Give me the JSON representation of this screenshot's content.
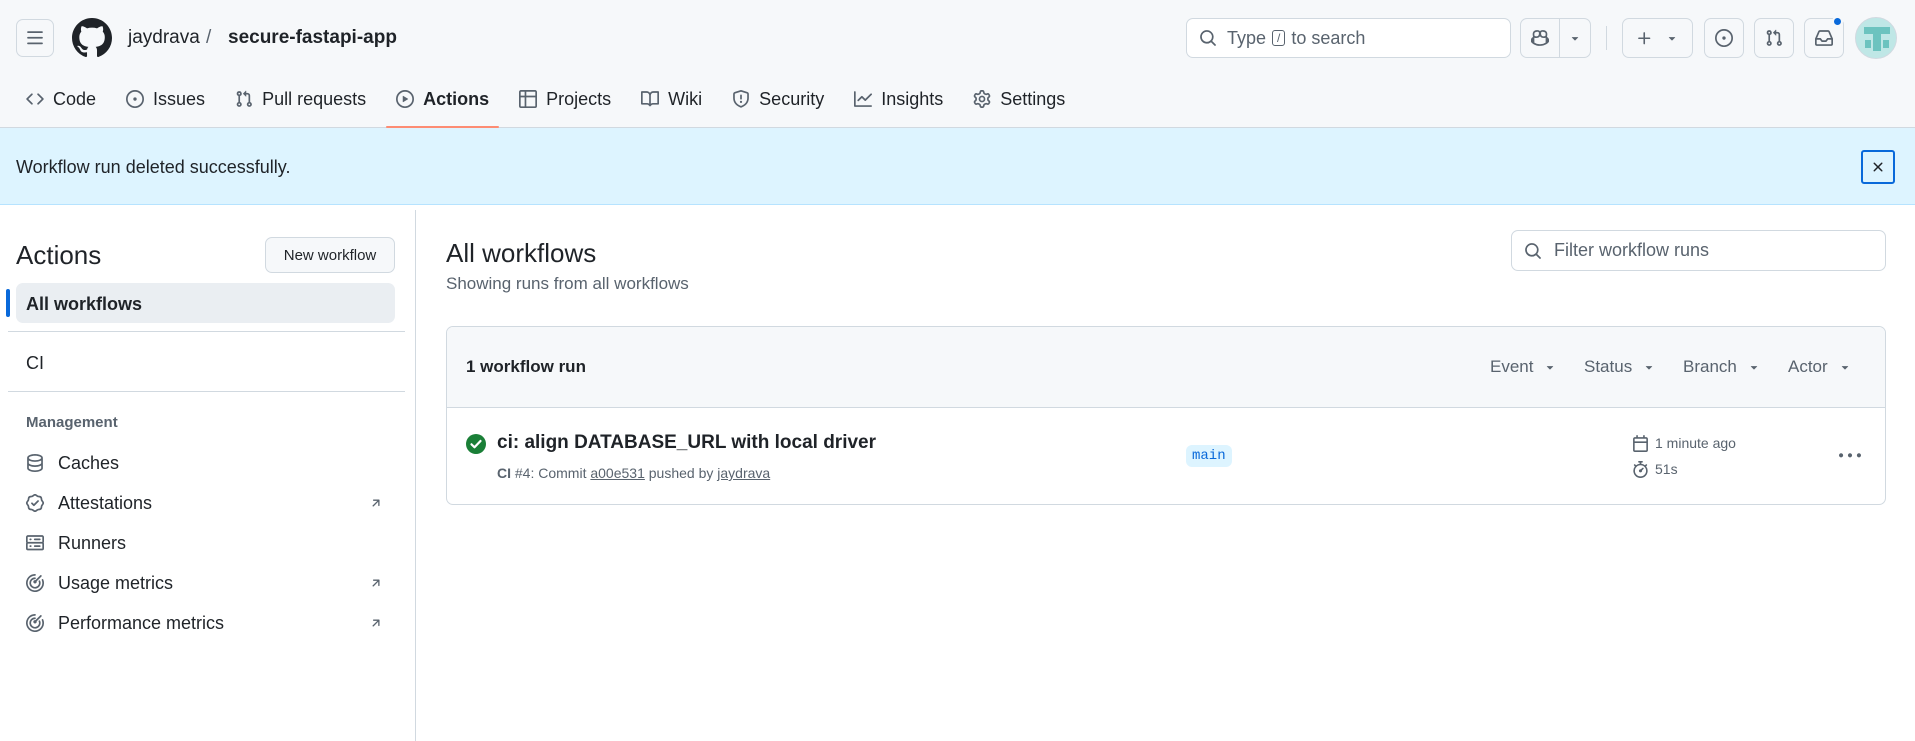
{
  "header": {
    "owner": "jaydrava",
    "separator": "/",
    "repo": "secure-fastapi-app",
    "search": {
      "prefix": "Type",
      "key": "/",
      "suffix": "to search"
    }
  },
  "tabs": [
    {
      "label": "Code",
      "icon": "code-icon"
    },
    {
      "label": "Issues",
      "icon": "issue-opened-icon"
    },
    {
      "label": "Pull requests",
      "icon": "git-pull-request-icon"
    },
    {
      "label": "Actions",
      "icon": "play-icon",
      "active": true
    },
    {
      "label": "Projects",
      "icon": "table-icon"
    },
    {
      "label": "Wiki",
      "icon": "book-icon"
    },
    {
      "label": "Security",
      "icon": "shield-icon"
    },
    {
      "label": "Insights",
      "icon": "graph-icon"
    },
    {
      "label": "Settings",
      "icon": "gear-icon"
    }
  ],
  "flash": {
    "message": "Workflow run deleted successfully."
  },
  "sidebar": {
    "title": "Actions",
    "new_workflow": "New workflow",
    "all_workflows": "All workflows",
    "workflows": [
      "CI"
    ],
    "management_heading": "Management",
    "management": [
      {
        "label": "Caches",
        "icon": "database-icon",
        "external": false
      },
      {
        "label": "Attestations",
        "icon": "verified-icon",
        "external": true
      },
      {
        "label": "Runners",
        "icon": "server-icon",
        "external": false
      },
      {
        "label": "Usage metrics",
        "icon": "meter-icon",
        "external": true
      },
      {
        "label": "Performance metrics",
        "icon": "meter-icon",
        "external": true
      }
    ]
  },
  "main": {
    "title": "All workflows",
    "subtitle": "Showing runs from all workflows",
    "filter_placeholder": "Filter workflow runs",
    "runs_count": "1 workflow run",
    "filters": [
      "Event",
      "Status",
      "Branch",
      "Actor"
    ],
    "runs": [
      {
        "title": "ci: align DATABASE_URL with local driver",
        "workflow": "CI",
        "run_number": "#4",
        "commit_prefix": ": Commit",
        "commit": "a00e531",
        "pushed_by": "pushed by",
        "actor": "jaydrava",
        "branch": "main",
        "time_ago": "1 minute ago",
        "duration": "51s",
        "status": "success"
      }
    ]
  },
  "colors": {
    "accent": "#0969da",
    "success": "#1a7f37",
    "active_tab_underline": "#fd8c73",
    "flash_bg": "#ddf4ff"
  }
}
